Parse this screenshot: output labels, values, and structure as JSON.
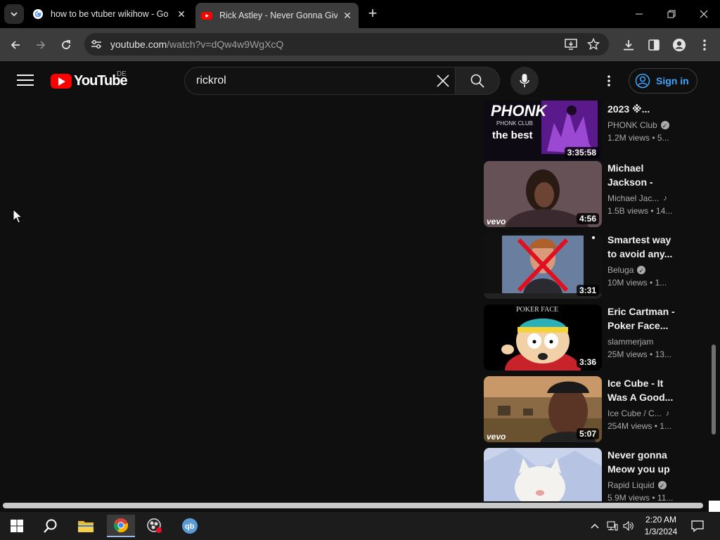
{
  "browser": {
    "tabs": [
      {
        "title": "how to be vtuber wikihow - Go",
        "favicon": "google-icon",
        "active": false
      },
      {
        "title": "Rick Astley - Never Gonna Give",
        "favicon": "youtube-icon",
        "active": true
      }
    ],
    "url_host": "youtube.com",
    "url_path": "/watch?v=dQw4w9WgXcQ"
  },
  "youtube": {
    "logo_text": "YouTube",
    "country_code": "DE",
    "search_query": "rickrol",
    "sign_in_label": "Sign in"
  },
  "recommendations": [
    {
      "title": "2023 ※...",
      "channel": "PHONK Club",
      "verified": true,
      "music": false,
      "views": "1.2M views",
      "age": "5...",
      "duration": "3:35:58",
      "thumb": "phonk"
    },
    {
      "title": "Michael Jackson - Billi...",
      "channel": "Michael Jac...",
      "verified": false,
      "music": true,
      "views": "1.5B views",
      "age": "14...",
      "duration": "4:56",
      "thumb": "mj"
    },
    {
      "title": "Smartest way to avoid any...",
      "channel": "Beluga",
      "verified": true,
      "music": false,
      "views": "10M views",
      "age": "1...",
      "duration": "3:31",
      "thumb": "rick"
    },
    {
      "title": "Eric Cartman - Poker Face...",
      "channel": "slammerjam",
      "verified": false,
      "music": false,
      "views": "25M views",
      "age": "13...",
      "duration": "3:36",
      "thumb": "cartman"
    },
    {
      "title": "Ice Cube - It Was A Good...",
      "channel": "Ice Cube / C...",
      "verified": false,
      "music": true,
      "views": "254M views",
      "age": "1...",
      "duration": "5:07",
      "thumb": "icecube"
    },
    {
      "title": "Never gonna Meow you up",
      "channel": "Rapid Liquid",
      "verified": true,
      "music": false,
      "views": "5.9M views",
      "age": "11...",
      "duration": "",
      "thumb": "cat"
    }
  ],
  "thumb_labels": {
    "phonk_big": "PHONK",
    "phonk_small": "PHONK CLUB",
    "phonk_best": "the best",
    "vevo": "vevo",
    "poker_face": "POKER FACE"
  },
  "taskbar": {
    "time": "2:20 AM",
    "date": "1/3/2024",
    "qbit_label": "qb"
  }
}
